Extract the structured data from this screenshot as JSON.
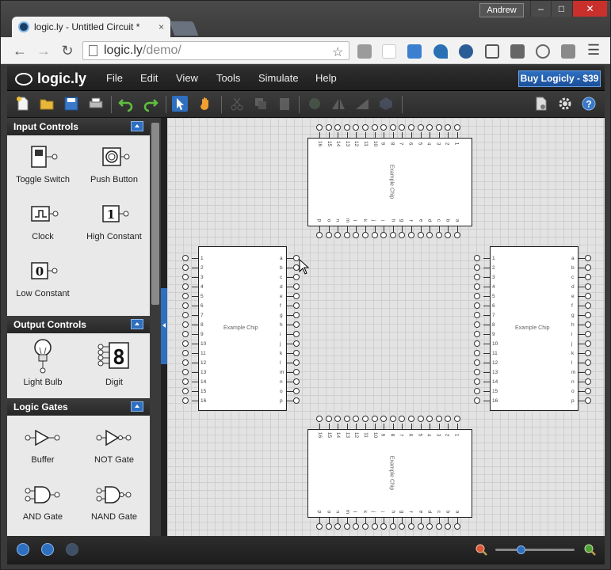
{
  "browser": {
    "tab_title": "logic.ly - Untitled Circuit *",
    "tab_close": "×",
    "user": "Andrew",
    "url_host": "logic.ly",
    "url_path": "/demo/",
    "window_buttons": [
      "–",
      "□",
      "✕"
    ]
  },
  "app": {
    "logo": "logic.ly",
    "menus": [
      "File",
      "Edit",
      "View",
      "Tools",
      "Simulate",
      "Help"
    ],
    "buy_label": "Buy Logicly - $39"
  },
  "sidebar": {
    "sections": [
      {
        "title": "Input Controls",
        "items": [
          {
            "label": "Toggle Switch",
            "icon": "toggle-switch-icon"
          },
          {
            "label": "Push Button",
            "icon": "push-button-icon"
          },
          {
            "label": "Clock",
            "icon": "clock-icon"
          },
          {
            "label": "High Constant",
            "icon": "high-constant-icon",
            "glyph": "1"
          },
          {
            "label": "Low Constant",
            "icon": "low-constant-icon",
            "glyph": "0"
          }
        ]
      },
      {
        "title": "Output Controls",
        "items": [
          {
            "label": "Light Bulb",
            "icon": "light-bulb-icon"
          },
          {
            "label": "Digit",
            "icon": "digit-icon",
            "glyph": "8"
          }
        ]
      },
      {
        "title": "Logic Gates",
        "items": [
          {
            "label": "Buffer",
            "icon": "buffer-gate-icon"
          },
          {
            "label": "NOT Gate",
            "icon": "not-gate-icon"
          },
          {
            "label": "AND Gate",
            "icon": "and-gate-icon"
          },
          {
            "label": "NAND Gate",
            "icon": "nand-gate-icon"
          }
        ]
      }
    ]
  },
  "canvas": {
    "chip_name": "Example Chip",
    "numbered_pins": [
      "1",
      "2",
      "3",
      "4",
      "5",
      "6",
      "7",
      "8",
      "9",
      "10",
      "11",
      "12",
      "13",
      "14",
      "15",
      "16"
    ],
    "lettered_pins": [
      "a",
      "b",
      "c",
      "d",
      "e",
      "f",
      "g",
      "h",
      "i",
      "j",
      "k",
      "l",
      "m",
      "n",
      "o",
      "p"
    ]
  },
  "colors": {
    "accent": "#2f6fc0",
    "appbar": "#262626",
    "canvas_bg": "#e3e3e3"
  }
}
